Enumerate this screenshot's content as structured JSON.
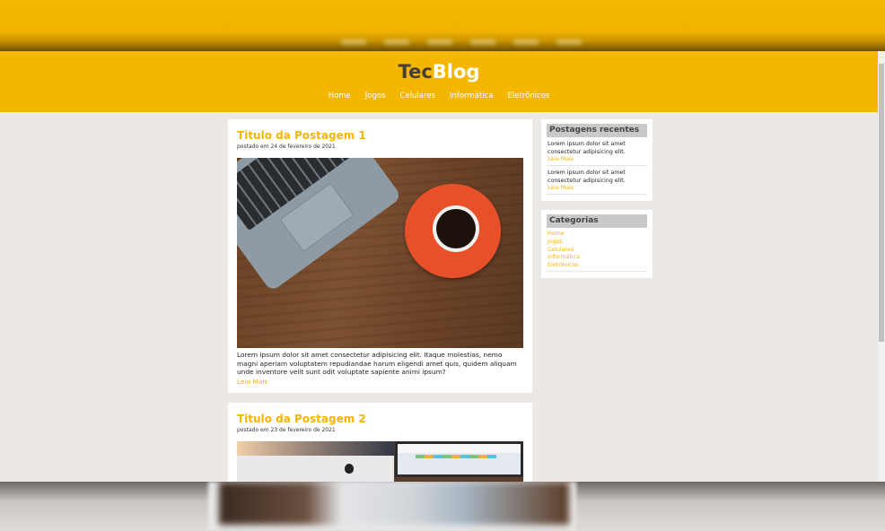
{
  "header": {
    "logo_part1": "Tec",
    "logo_part2": "Blog",
    "nav": [
      "Home",
      "Jogos",
      "Celulares",
      "Informática",
      "Eletrônicos"
    ]
  },
  "posts": [
    {
      "title": "Titulo da Postagem 1",
      "date": "postado em 24 de fevereiro de 2021",
      "excerpt": "Lorem ipsum dolor sit amet consectetur adipisicing elit. Itaque molestias, nemo magni aperiam voluptatem repudiandae harum eligendi amet quis, quidem aliquam unde inventore velit sunt odit voluptate sapiente animi ipsum?",
      "read_more": "Leia Mais"
    },
    {
      "title": "Titulo da Postagem 2",
      "date": "postado em 23 de fevereiro de 2021"
    }
  ],
  "sidebar": {
    "recent": {
      "title": "Postagens recentes",
      "items": [
        {
          "text": "Lorem ipsum dolor sit amet consectetur adipisicing elit.",
          "link": "Leia Mais"
        },
        {
          "text": "Lorem ipsum dolor sit amet consectetur adipisicing elit.",
          "link": "Leia Mais"
        }
      ]
    },
    "categories": {
      "title": "Categorias",
      "items": [
        "Home",
        "Jogos",
        "Celulares",
        "Informática",
        "Eletrônicos"
      ]
    }
  },
  "colors": {
    "accent": "#f5b600",
    "logo_dark": "#4a3e33",
    "background": "#ece8e6"
  }
}
